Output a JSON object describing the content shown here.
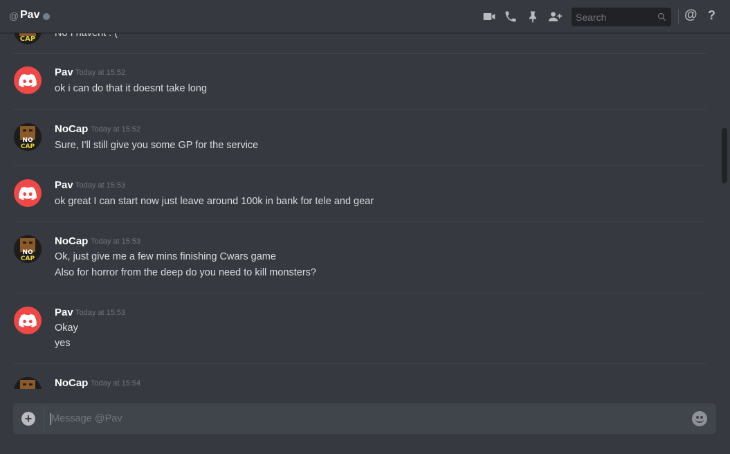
{
  "header": {
    "at_symbol": "@",
    "channel_name": "Pav",
    "search_placeholder": "Search",
    "mention_label": "@",
    "help_label": "?"
  },
  "icons": {
    "video": "video-camera-icon",
    "call": "phone-icon",
    "pin": "pin-icon",
    "add_friend": "add-user-icon",
    "search": "search-icon",
    "status": "offline-status-dot"
  },
  "colors": {
    "background": "#36393f",
    "discord_red": "#f04747",
    "text": "#dcddde",
    "muted": "#72767d"
  },
  "partial_top_message": {
    "line": "No I havent : ("
  },
  "messages": [
    {
      "author": "Pav",
      "avatar": "discord-default-avatar",
      "timestamp": "Today at 15:52",
      "lines": [
        "ok i can do that it doesnt take long"
      ]
    },
    {
      "author": "NoCap",
      "avatar": "nocap-avatar",
      "timestamp": "Today at 15:52",
      "lines": [
        "Sure, I'll still give you some GP for the service"
      ]
    },
    {
      "author": "Pav",
      "avatar": "discord-default-avatar",
      "timestamp": "Today at 15:53",
      "lines": [
        "ok great I can start now just leave around 100k in bank for tele and gear"
      ]
    },
    {
      "author": "NoCap",
      "avatar": "nocap-avatar",
      "timestamp": "Today at 15:53",
      "lines": [
        "Ok, just give me a few mins finishing Cwars game",
        "Also for horror from the deep do you need to kill monsters?"
      ]
    },
    {
      "author": "Pav",
      "avatar": "discord-default-avatar",
      "timestamp": "Today at 15:53",
      "lines": [
        "Okay",
        "yes"
      ]
    },
    {
      "author": "NoCap",
      "avatar": "nocap-avatar",
      "timestamp": "Today at 15:54",
      "lines": []
    }
  ],
  "composer": {
    "placeholder": "Message @Pav",
    "add_label": "+"
  }
}
